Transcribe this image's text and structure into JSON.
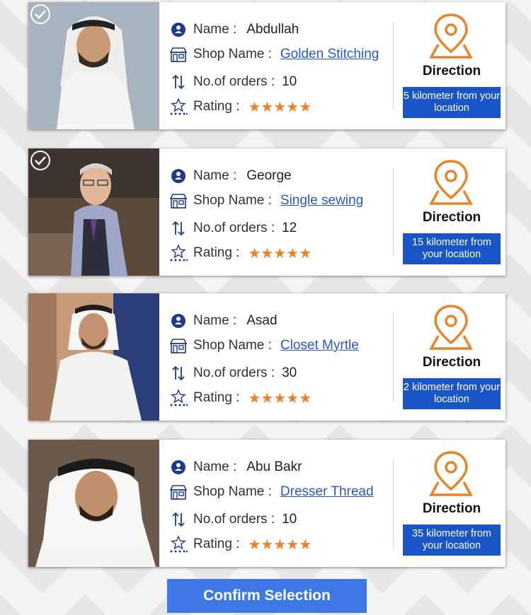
{
  "labels": {
    "name": "Name :",
    "shop": "Shop Name :",
    "orders": "No.of orders :",
    "rating": "Rating :",
    "direction": "Direction"
  },
  "tailors": [
    {
      "name": "Abdullah",
      "shop": "Golden Stitching",
      "orders": "10",
      "rating": 5,
      "distance": "5 kilometer from your location",
      "selected": true
    },
    {
      "name": "George",
      "shop": "Single sewing",
      "orders": "12",
      "rating": 5,
      "distance": "15 kilometer from your location",
      "selected": true
    },
    {
      "name": "Asad",
      "shop": "Closet Myrtle",
      "orders": "30",
      "rating": 5,
      "distance": "2 kilometer from your location",
      "selected": false
    },
    {
      "name": "Abu Bakr",
      "shop": "Dresser Thread",
      "orders": "10",
      "rating": 5,
      "distance": "35 kilometer from your location",
      "selected": false
    }
  ],
  "confirm_label": "Confirm Selection",
  "colors": {
    "accent": "#1a55c8",
    "button": "#3d78e6",
    "star": "#e8832b",
    "pin": "#e8832b",
    "link": "#2a55c9",
    "icon": "#1f3a8a"
  },
  "icons": {
    "name": "person-circle-icon",
    "shop": "shop-icon",
    "orders": "sort-arrows-icon",
    "rating": "star-rating-icon",
    "pin": "location-pin-icon",
    "check": "check-circle-icon"
  }
}
